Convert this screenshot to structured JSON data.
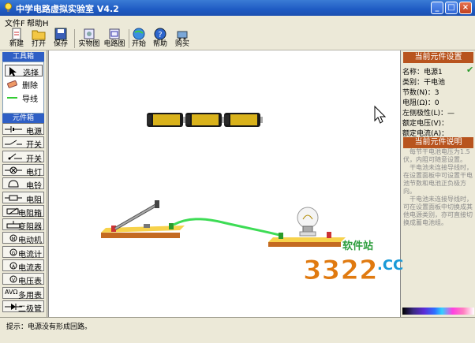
{
  "window": {
    "title": "中学电路虚拟实验室 V4.2",
    "minimize_label": "_",
    "maximize_label": "□",
    "close_label": "×"
  },
  "menu": {
    "file": "文件F",
    "help": "帮助H"
  },
  "toolbar": {
    "new": "新建",
    "open": "打开",
    "save": "保存",
    "real_view": "实物图",
    "circuit_view": "电路图",
    "start": "开始",
    "help": "帮助",
    "buy": "购买"
  },
  "toolbox": {
    "header": "工具箱",
    "select": "选择",
    "delete": "删除",
    "wire": "导线"
  },
  "components": {
    "header": "元件箱",
    "items": [
      "电源",
      "开关",
      "开关",
      "电灯",
      "电铃",
      "电阻",
      "电阻箱",
      "变阻器",
      "电动机",
      "电流计",
      "电流表",
      "电压表",
      "多用表",
      "二极管"
    ],
    "icons": [
      "battery-icon",
      "switch-icon",
      "single-pole-switch-icon",
      "lamp-icon",
      "bell-icon",
      "resistor-icon",
      "resistor-box-icon",
      "rheostat-icon",
      "motor-icon",
      "galvanometer-icon",
      "ammeter-icon",
      "voltmeter-icon",
      "multimeter-icon",
      "diode-icon"
    ],
    "multimeter_prefix": "AVΩ"
  },
  "properties": {
    "header": "当前元件设置",
    "name": "名称：电源1",
    "type": "类别：干电池",
    "count": "节数(N)：3",
    "resistance": "电阻(Ω)：0",
    "left_polarity": "左侧极性(L)：—",
    "rated_voltage": "额定电压(V)：",
    "rated_current": "额定电流(A)："
  },
  "explanation": {
    "header": "当前元件说明",
    "paragraphs": [
      "每节干电池电压为1.5伏，内阻可随意设置。",
      "干电池未连接导线时，在设置面板中可设置干电池节数和电池正负极方向。",
      "干电池未连接导线时，可在设置面板中切换成其他电源类别，亦可直接切换成蓄电池组。"
    ]
  },
  "status": {
    "tip": "提示：电源没有形成回路。"
  },
  "watermark": {
    "brand": "软件站",
    "number": "3322",
    "domain": ".CC"
  },
  "colors": {
    "title_blue": "#1f5bc3",
    "panel_header": "#b8541e",
    "wire": "#3ddc55",
    "battery": "#d9b21b"
  }
}
